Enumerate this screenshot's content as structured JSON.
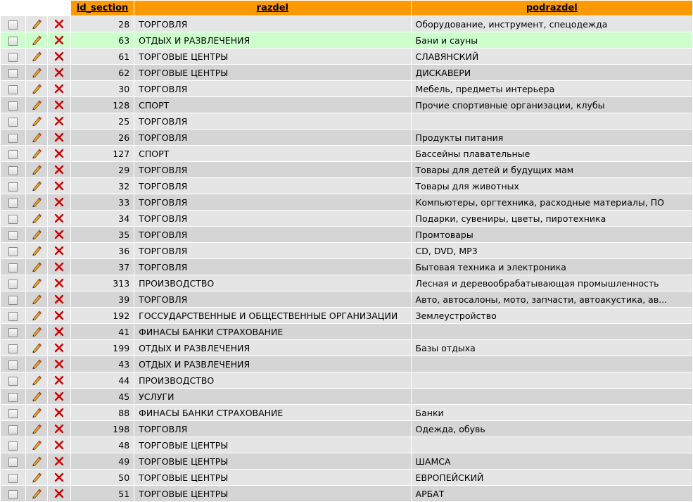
{
  "columns": {
    "id_section": "id_section",
    "razdel": "razdel",
    "podrazdel": "podrazdel"
  },
  "icons": {
    "edit": "pencil-icon",
    "delete": "red-cross-icon"
  },
  "colors": {
    "header": "#ff9900",
    "row_odd": "#e5e5e5",
    "row_even": "#d5d5d5",
    "row_highlight": "#ccffcc",
    "delete": "#cc0000"
  },
  "rows": [
    {
      "id": "28",
      "razdel": "ТОРГОВЛЯ",
      "podrazdel": "Оборудование, инструмент, спецодежда"
    },
    {
      "id": "63",
      "razdel": "ОТДЫХ И РАЗВЛЕЧЕНИЯ",
      "podrazdel": "Бани и сауны",
      "highlight": true
    },
    {
      "id": "61",
      "razdel": "ТОРГОВЫЕ ЦЕНТРЫ",
      "podrazdel": "СЛАВЯНСКИЙ"
    },
    {
      "id": "62",
      "razdel": "ТОРГОВЫЕ ЦЕНТРЫ",
      "podrazdel": "ДИСКАВЕРИ"
    },
    {
      "id": "30",
      "razdel": "ТОРГОВЛЯ",
      "podrazdel": "Мебель, предметы интерьера"
    },
    {
      "id": "128",
      "razdel": "СПОРТ",
      "podrazdel": "Прочие спортивные организации, клубы"
    },
    {
      "id": "25",
      "razdel": "ТОРГОВЛЯ",
      "podrazdel": ""
    },
    {
      "id": "26",
      "razdel": "ТОРГОВЛЯ",
      "podrazdel": "Продукты питания"
    },
    {
      "id": "127",
      "razdel": "СПОРТ",
      "podrazdel": "Бассейны плавательные"
    },
    {
      "id": "29",
      "razdel": "ТОРГОВЛЯ",
      "podrazdel": "Товары для детей и будущих мам"
    },
    {
      "id": "32",
      "razdel": "ТОРГОВЛЯ",
      "podrazdel": "Товары для животных"
    },
    {
      "id": "33",
      "razdel": "ТОРГОВЛЯ",
      "podrazdel": "Компьютеры, оргтехника, расходные материалы, ПО"
    },
    {
      "id": "34",
      "razdel": "ТОРГОВЛЯ",
      "podrazdel": "Подарки, сувениры, цветы, пиротехника"
    },
    {
      "id": "35",
      "razdel": "ТОРГОВЛЯ",
      "podrazdel": "Промтовары"
    },
    {
      "id": "36",
      "razdel": "ТОРГОВЛЯ",
      "podrazdel": "CD, DVD, MP3"
    },
    {
      "id": "37",
      "razdel": "ТОРГОВЛЯ",
      "podrazdel": "Бытовая техника и электроника"
    },
    {
      "id": "313",
      "razdel": "ПРОИЗВОДСТВО",
      "podrazdel": "Лесная и деревообрабатывающая промышленность"
    },
    {
      "id": "39",
      "razdel": "ТОРГОВЛЯ",
      "podrazdel": "Авто, автосалоны, мото, запчасти, автоакустика, ав..."
    },
    {
      "id": "192",
      "razdel": "ГОССУДАРСТВЕННЫЕ И ОБЩЕСТВЕННЫЕ ОРГАНИЗАЦИИ",
      "podrazdel": "Землеустройство"
    },
    {
      "id": "41",
      "razdel": "ФИНАСЫ БАНКИ СТРАХОВАНИЕ",
      "podrazdel": ""
    },
    {
      "id": "199",
      "razdel": "ОТДЫХ И РАЗВЛЕЧЕНИЯ",
      "podrazdel": "Базы отдыха"
    },
    {
      "id": "43",
      "razdel": "ОТДЫХ И РАЗВЛЕЧЕНИЯ",
      "podrazdel": ""
    },
    {
      "id": "44",
      "razdel": "ПРОИЗВОДСТВО",
      "podrazdel": ""
    },
    {
      "id": "45",
      "razdel": "УСЛУГИ",
      "podrazdel": ""
    },
    {
      "id": "88",
      "razdel": "ФИНАСЫ БАНКИ СТРАХОВАНИЕ",
      "podrazdel": "Банки"
    },
    {
      "id": "198",
      "razdel": "ТОРГОВЛЯ",
      "podrazdel": "Одежда, обувь"
    },
    {
      "id": "48",
      "razdel": "ТОРГОВЫЕ ЦЕНТРЫ",
      "podrazdel": ""
    },
    {
      "id": "49",
      "razdel": "ТОРГОВЫЕ ЦЕНТРЫ",
      "podrazdel": "ШАМСА"
    },
    {
      "id": "50",
      "razdel": "ТОРГОВЫЕ ЦЕНТРЫ",
      "podrazdel": "ЕВРОПЕЙСКИЙ"
    },
    {
      "id": "51",
      "razdel": "ТОРГОВЫЕ ЦЕНТРЫ",
      "podrazdel": "АРБАТ"
    }
  ]
}
